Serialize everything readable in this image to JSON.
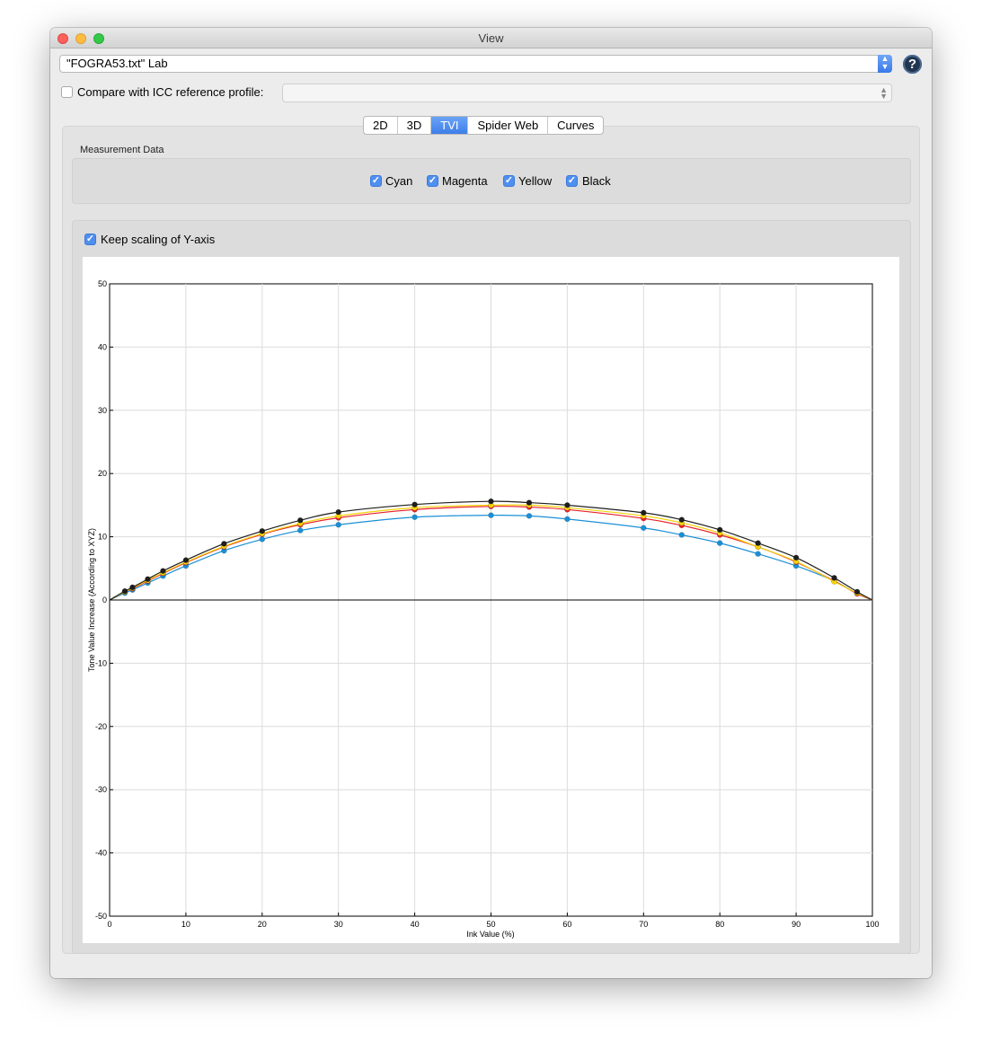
{
  "window": {
    "title": "View"
  },
  "source_combo": {
    "value": "\"FOGRA53.txt\" Lab"
  },
  "help_button": {
    "label": "?"
  },
  "compare": {
    "label": "Compare with ICC reference profile:",
    "checked": false,
    "profile_value": ""
  },
  "tabs": [
    {
      "label": "2D",
      "active": false
    },
    {
      "label": "3D",
      "active": false
    },
    {
      "label": "TVI",
      "active": true
    },
    {
      "label": "Spider Web",
      "active": false
    },
    {
      "label": "Curves",
      "active": false
    }
  ],
  "measurement": {
    "title": "Measurement Data",
    "channels": [
      {
        "label": "Cyan",
        "checked": true
      },
      {
        "label": "Magenta",
        "checked": true
      },
      {
        "label": "Yellow",
        "checked": true
      },
      {
        "label": "Black",
        "checked": true
      }
    ]
  },
  "keep_scaling": {
    "label": "Keep scaling of Y-axis",
    "checked": true
  },
  "chart_data": {
    "type": "line",
    "xlabel": "Ink Value (%)",
    "ylabel": "Tone Value Increase (According to XYZ)",
    "xlim": [
      0,
      100
    ],
    "ylim": [
      -50,
      50
    ],
    "xticks": [
      0,
      10,
      20,
      30,
      40,
      50,
      60,
      70,
      80,
      90,
      100
    ],
    "yticks": [
      -50,
      -40,
      -30,
      -20,
      -10,
      0,
      10,
      20,
      30,
      40,
      50
    ],
    "grid": true,
    "x": [
      0,
      2,
      3,
      5,
      7,
      10,
      15,
      20,
      25,
      30,
      40,
      50,
      55,
      60,
      70,
      75,
      80,
      85,
      90,
      95,
      98,
      100
    ],
    "series": [
      {
        "color": "#1a8fd6",
        "values": [
          0,
          1.1,
          1.6,
          2.7,
          3.8,
          5.4,
          7.8,
          9.6,
          11.0,
          11.9,
          13.1,
          13.4,
          13.3,
          12.8,
          11.4,
          10.3,
          9.0,
          7.3,
          5.4,
          3.0,
          1.0,
          0
        ]
      },
      {
        "color": "#e8202a",
        "values": [
          0,
          1.3,
          1.8,
          3.0,
          4.2,
          5.9,
          8.4,
          10.4,
          11.9,
          13.0,
          14.3,
          14.8,
          14.7,
          14.3,
          12.9,
          11.8,
          10.3,
          8.4,
          6.0,
          3.0,
          1.0,
          0
        ]
      },
      {
        "color": "#f5d20a",
        "values": [
          0,
          1.3,
          1.9,
          3.1,
          4.3,
          6.0,
          8.5,
          10.5,
          12.1,
          13.3,
          14.6,
          15.0,
          15.0,
          14.6,
          13.3,
          12.2,
          10.6,
          8.4,
          6.1,
          2.9,
          1.1,
          0
        ]
      },
      {
        "color": "#1e1e1e",
        "values": [
          0,
          1.4,
          2.0,
          3.3,
          4.6,
          6.3,
          8.9,
          10.9,
          12.6,
          13.9,
          15.1,
          15.6,
          15.4,
          15.0,
          13.8,
          12.7,
          11.1,
          9.0,
          6.7,
          3.5,
          1.3,
          0
        ]
      }
    ]
  }
}
